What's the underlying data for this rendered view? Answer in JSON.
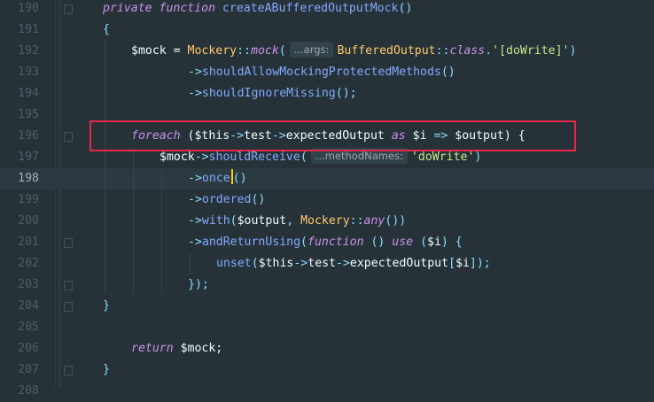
{
  "editor": {
    "lines": [
      {
        "num": "190",
        "indent": 1,
        "tokens": [
          [
            "kw",
            "private function "
          ],
          [
            "fn",
            "createABufferedOutputMock"
          ],
          [
            "punc",
            "()"
          ]
        ]
      },
      {
        "num": "191",
        "indent": 1,
        "tokens": [
          [
            "punc",
            "{"
          ]
        ]
      },
      {
        "num": "192",
        "indent": 2,
        "tokens": [
          [
            "var",
            "$mock"
          ],
          [
            "plain",
            " = "
          ],
          [
            "cls",
            "Mockery"
          ],
          [
            "op",
            "::"
          ],
          [
            "kw",
            "mock"
          ],
          [
            "punc",
            "("
          ],
          [
            "hint",
            "...args:"
          ],
          [
            "cls",
            "BufferedOutput"
          ],
          [
            "op",
            "::"
          ],
          [
            "kw",
            "class"
          ],
          [
            "op",
            "."
          ],
          [
            "str",
            "'[doWrite]'"
          ],
          [
            "punc",
            ")"
          ]
        ]
      },
      {
        "num": "193",
        "indent": 4,
        "tokens": [
          [
            "op",
            "->"
          ],
          [
            "fn",
            "shouldAllowMockingProtectedMethods"
          ],
          [
            "punc",
            "()"
          ]
        ]
      },
      {
        "num": "194",
        "indent": 4,
        "tokens": [
          [
            "op",
            "->"
          ],
          [
            "fn",
            "shouldIgnoreMissing"
          ],
          [
            "punc",
            "();"
          ]
        ]
      },
      {
        "num": "195",
        "indent": 0,
        "tokens": []
      },
      {
        "num": "196",
        "indent": 2,
        "tokens": [
          [
            "kw",
            "foreach"
          ],
          [
            "plain",
            " ("
          ],
          [
            "var",
            "$this"
          ],
          [
            "op",
            "->"
          ],
          [
            "plain",
            "test"
          ],
          [
            "op",
            "->"
          ],
          [
            "plain",
            "expectedOutput "
          ],
          [
            "kw",
            "as"
          ],
          [
            "plain",
            " $i "
          ],
          [
            "op",
            "=>"
          ],
          [
            "plain",
            " $output) {"
          ]
        ]
      },
      {
        "num": "197",
        "indent": 3,
        "tokens": [
          [
            "var",
            "$mock"
          ],
          [
            "op",
            "->"
          ],
          [
            "fn",
            "shouldReceive"
          ],
          [
            "punc",
            "("
          ],
          [
            "hint",
            "...methodNames:"
          ],
          [
            "str",
            "'doWrite'"
          ],
          [
            "punc",
            ")"
          ]
        ]
      },
      {
        "num": "198",
        "indent": 4,
        "current": true,
        "tokens": [
          [
            "op",
            "->"
          ],
          [
            "fn",
            "once"
          ],
          [
            "punc",
            "()"
          ]
        ]
      },
      {
        "num": "199",
        "indent": 4,
        "tokens": [
          [
            "op",
            "->"
          ],
          [
            "fn",
            "ordered"
          ],
          [
            "punc",
            "()"
          ]
        ]
      },
      {
        "num": "200",
        "indent": 4,
        "tokens": [
          [
            "op",
            "->"
          ],
          [
            "fn",
            "with"
          ],
          [
            "punc",
            "("
          ],
          [
            "var",
            "$output"
          ],
          [
            "punc",
            ", "
          ],
          [
            "cls",
            "Mockery"
          ],
          [
            "op",
            "::"
          ],
          [
            "kw",
            "any"
          ],
          [
            "punc",
            "())"
          ]
        ]
      },
      {
        "num": "201",
        "indent": 4,
        "tokens": [
          [
            "op",
            "->"
          ],
          [
            "fn",
            "andReturnUsing"
          ],
          [
            "punc",
            "("
          ],
          [
            "kw",
            "function"
          ],
          [
            "punc",
            " () "
          ],
          [
            "kw",
            "use"
          ],
          [
            "punc",
            " ("
          ],
          [
            "var",
            "$i"
          ],
          [
            "punc",
            ") {"
          ]
        ]
      },
      {
        "num": "202",
        "indent": 5,
        "tokens": [
          [
            "fn",
            "unset"
          ],
          [
            "punc",
            "("
          ],
          [
            "var",
            "$this"
          ],
          [
            "op",
            "->"
          ],
          [
            "plain",
            "test"
          ],
          [
            "op",
            "->"
          ],
          [
            "plain",
            "expectedOutput"
          ],
          [
            "punc",
            "["
          ],
          [
            "var",
            "$i"
          ],
          [
            "punc",
            "]);"
          ]
        ]
      },
      {
        "num": "203",
        "indent": 4,
        "tokens": [
          [
            "punc",
            "});"
          ]
        ]
      },
      {
        "num": "204",
        "indent": 1,
        "tokens": [
          [
            "punc",
            "}"
          ]
        ]
      },
      {
        "num": "205",
        "indent": 0,
        "tokens": []
      },
      {
        "num": "206",
        "indent": 2,
        "tokens": [
          [
            "kw",
            "return"
          ],
          [
            "plain",
            " $mock;"
          ]
        ]
      },
      {
        "num": "207",
        "indent": 1,
        "tokens": [
          [
            "punc",
            "}"
          ]
        ]
      },
      {
        "num": "208",
        "indent": 0,
        "tokens": []
      }
    ],
    "fold_lines": [
      "190",
      "196",
      "201",
      "203",
      "204",
      "207"
    ],
    "highlight_line": "196"
  }
}
